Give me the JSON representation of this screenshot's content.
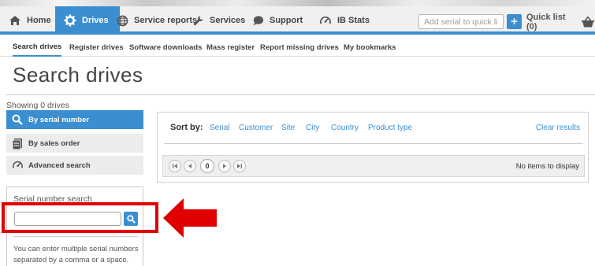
{
  "nav": {
    "home": "Home",
    "drives": "Drives",
    "service_reports": "Service reports",
    "services": "Services",
    "support": "Support",
    "ib_stats": "IB Stats"
  },
  "quick": {
    "placeholder": "Add serial to quick list",
    "add_symbol": "+",
    "list_label": "Quick list (0)"
  },
  "subnav": {
    "search_drives": "Search drives",
    "register_drives": "Register drives",
    "software_downloads": "Software downloads",
    "mass_register": "Mass register",
    "report_missing": "Report missing drives",
    "my_bookmarks": "My bookmarks"
  },
  "page": {
    "title": "Search drives",
    "showing": "Showing 0 drives"
  },
  "modes": {
    "serial": "By serial number",
    "sales": "By sales order",
    "advanced": "Advanced search"
  },
  "results": {
    "sort_label": "Sort by:",
    "sort_options": [
      "Serial",
      "Customer",
      "Site",
      "City",
      "Country",
      "Product type"
    ],
    "clear": "Clear results",
    "page_number": "0",
    "no_items": "No items to display"
  },
  "serial_search": {
    "title": "Serial number search",
    "value": "",
    "help": "You can enter multiple serial numbers separated by a comma or a space."
  },
  "colors": {
    "accent": "#3b8fd1",
    "highlight": "#e00000"
  }
}
